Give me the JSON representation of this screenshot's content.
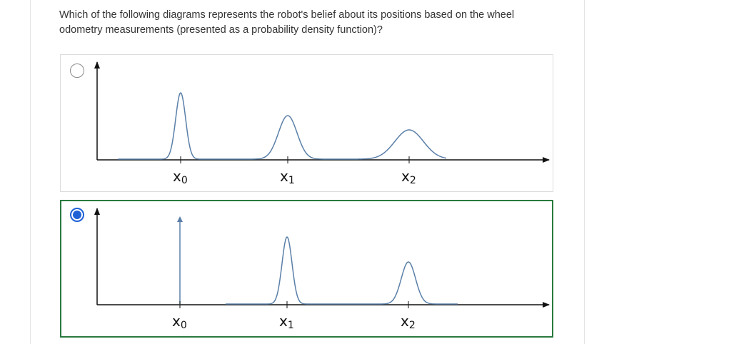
{
  "question": {
    "text": "Which of the following diagrams represents the robot's belief about its positions based on the wheel odometry measurements (presented as a probability density function)?"
  },
  "options": [
    {
      "selected": false,
      "labels": [
        {
          "main": "x",
          "sub": "0"
        },
        {
          "main": "x",
          "sub": "1"
        },
        {
          "main": "x",
          "sub": "2"
        }
      ]
    },
    {
      "selected": true,
      "labels": [
        {
          "main": "x",
          "sub": "0"
        },
        {
          "main": "x",
          "sub": "1"
        },
        {
          "main": "x",
          "sub": "2"
        }
      ]
    }
  ],
  "colors": {
    "curve": "#5a7fa8",
    "axis": "#111111",
    "selected_border": "#2a7a3f",
    "radio_selected": "#1f62d6"
  }
}
